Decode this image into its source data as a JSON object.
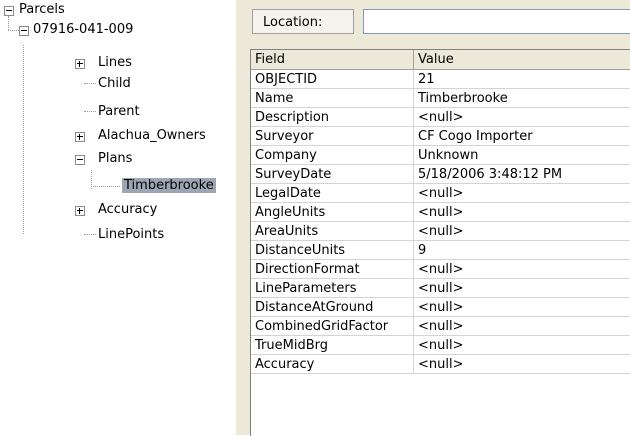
{
  "tree": {
    "root": "Parcels",
    "parcel": "07916-041-009",
    "children": [
      "Lines",
      "Child",
      "Parent",
      "Alachua_Owners",
      "Plans",
      "Accuracy",
      "LinePoints"
    ],
    "plan_item": "Timberbrooke"
  },
  "location": {
    "label": "Location:",
    "value": ""
  },
  "grid": {
    "headers": [
      "Field",
      "Value"
    ],
    "rows": [
      [
        "OBJECTID",
        "21"
      ],
      [
        "Name",
        "Timberbrooke"
      ],
      [
        "Description",
        "<null>"
      ],
      [
        "Surveyor",
        "CF Cogo Importer"
      ],
      [
        "Company",
        "Unknown"
      ],
      [
        "SurveyDate",
        "5/18/2006 3:48:12 PM"
      ],
      [
        "LegalDate",
        "<null>"
      ],
      [
        "AngleUnits",
        "<null>"
      ],
      [
        "AreaUnits",
        "<null>"
      ],
      [
        "DistanceUnits",
        "9"
      ],
      [
        "DirectionFormat",
        "<null>"
      ],
      [
        "LineParameters",
        "<null>"
      ],
      [
        "DistanceAtGround",
        "<null>"
      ],
      [
        "CombinedGridFactor",
        "<null>"
      ],
      [
        "TrueMidBrg",
        "<null>"
      ],
      [
        "Accuracy",
        "<null>"
      ]
    ]
  }
}
